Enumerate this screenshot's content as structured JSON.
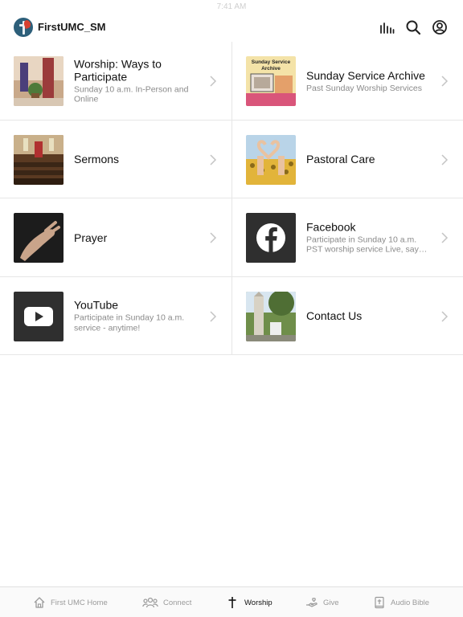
{
  "statusbar": {
    "time": "7:41 AM"
  },
  "header": {
    "title": "FirstUMC_SM"
  },
  "rows": [
    {
      "left": {
        "title": "Worship: Ways to Participate",
        "subtitle": "Sunday 10 a.m. In-Person and Online"
      },
      "right": {
        "title": "Sunday Service Archive",
        "subtitle": "Past Sunday Worship Services",
        "thumb_text": "Sunday Service Archive"
      }
    },
    {
      "left": {
        "title": "Sermons",
        "subtitle": ""
      },
      "right": {
        "title": "Pastoral Care",
        "subtitle": ""
      }
    },
    {
      "left": {
        "title": "Prayer",
        "subtitle": ""
      },
      "right": {
        "title": "Facebook",
        "subtitle": "Participate in Sunday 10 a.m. PST worship service Live, say…"
      }
    },
    {
      "left": {
        "title": "YouTube",
        "subtitle": "Participate in Sunday 10 a.m. service - anytime!"
      },
      "right": {
        "title": "Contact Us",
        "subtitle": ""
      }
    }
  ],
  "tabs": [
    {
      "label": "First UMC Home",
      "icon": "home-icon"
    },
    {
      "label": "Connect",
      "icon": "people-icon"
    },
    {
      "label": "Worship",
      "icon": "cross-icon",
      "active": true
    },
    {
      "label": "Give",
      "icon": "giving-hand-icon"
    },
    {
      "label": "Audio Bible",
      "icon": "bible-icon"
    }
  ],
  "colors": {
    "accent": "#111111",
    "inactive_tab": "#9a9a9a",
    "divider": "#e6e6e6",
    "logo_bg": "#2d5f7a"
  }
}
